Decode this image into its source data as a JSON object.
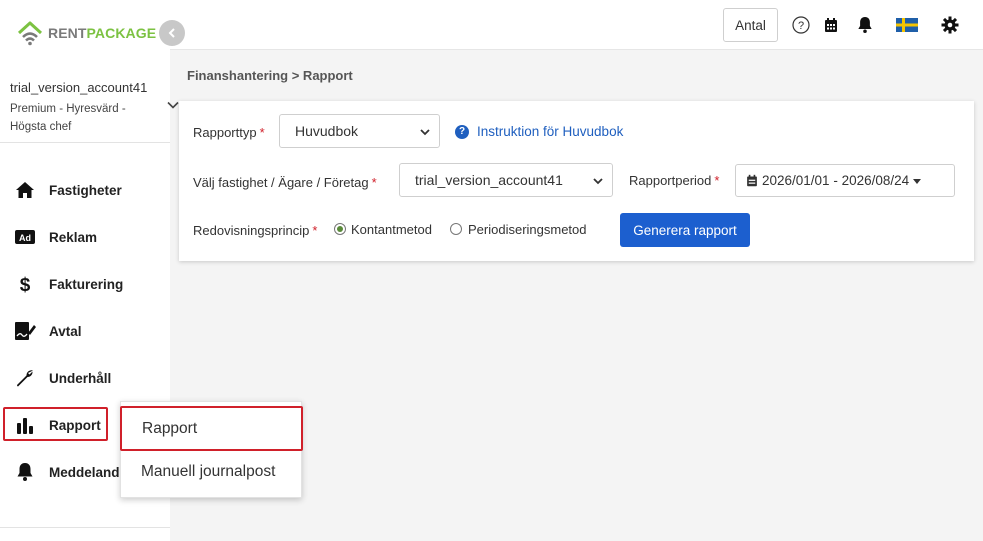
{
  "logo": {
    "rent": "RENT",
    "package": "PACKAGE",
    "brand_color": "#7cc242"
  },
  "account": {
    "name": "trial_version_account41",
    "role": "Premium - Hyresvärd - Högsta chef"
  },
  "sidebar": {
    "items": [
      {
        "label": "Fastigheter",
        "icon": "home-icon"
      },
      {
        "label": "Reklam",
        "icon": "ad-icon"
      },
      {
        "label": "Fakturering",
        "icon": "dollar-icon"
      },
      {
        "label": "Avtal",
        "icon": "contract-icon"
      },
      {
        "label": "Underhåll",
        "icon": "wrench-icon"
      },
      {
        "label": "Rapport",
        "icon": "bar-chart-icon"
      },
      {
        "label": "Meddeland",
        "icon": "bell-icon"
      }
    ]
  },
  "header": {
    "antal_label": "Antal",
    "icons": [
      "help-icon",
      "calendar-icon",
      "bell-icon",
      "swedish-flag-icon",
      "gear-icon"
    ]
  },
  "breadcrumb": "Finanshantering > Rapport",
  "form": {
    "rapporttyp_label": "Rapporttyp",
    "rapporttyp_value": "Huvudbok",
    "instruction_link": "Instruktion för Huvudbok",
    "property_label": "Välj fastighet / Ägare / Företag",
    "property_value": "trial_version_account41",
    "period_label": "Rapportperiod",
    "period_value": "2026/01/01 - 2026/08/24",
    "principle_label": "Redovisningsprincip",
    "option_cash": "Kontantmetod",
    "option_accrual": "Periodiseringsmetod",
    "selected_option": "Kontantmetod",
    "generate_button": "Generera rapport",
    "required_mark": "*"
  },
  "submenu": {
    "items": [
      "Rapport",
      "Manuell journalpost"
    ]
  },
  "colors": {
    "primary": "#1c5fcf",
    "required": "#d0202a",
    "highlight": "#d0202a"
  }
}
